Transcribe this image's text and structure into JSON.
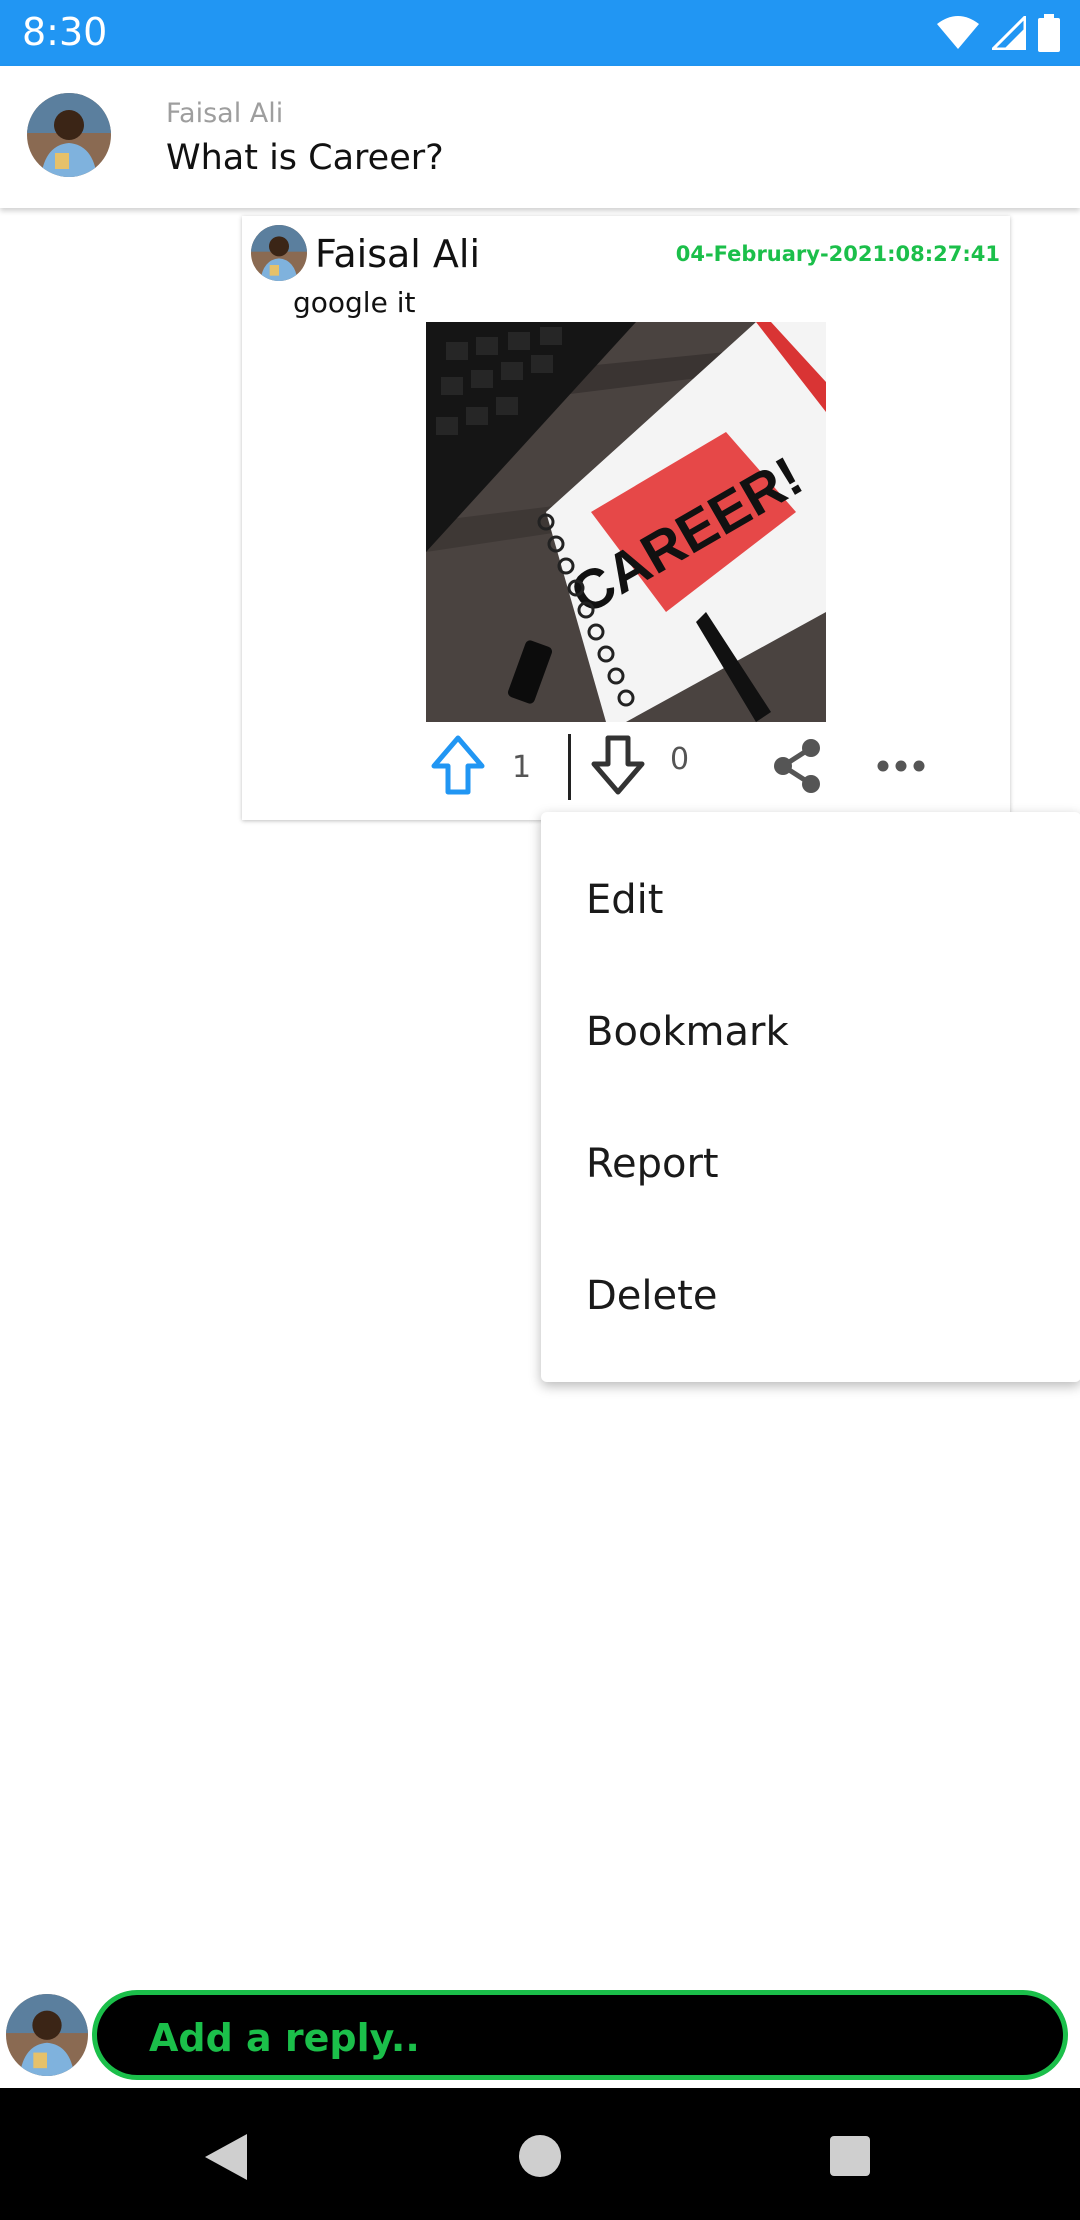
{
  "status_bar": {
    "time": "8:30"
  },
  "header": {
    "author": "Faisal Ali",
    "title": "What is Career?"
  },
  "answer": {
    "author": "Faisal Ali",
    "timestamp": "04-February-2021:08:27:41",
    "text": "google it",
    "image_text": "CAREER!",
    "upvotes": "1",
    "downvotes": "0"
  },
  "menu": {
    "items": [
      "Edit",
      "Bookmark",
      "Report",
      "Delete"
    ]
  },
  "reply": {
    "placeholder": "Add a reply.."
  },
  "colors": {
    "status_bar": "#2196F3",
    "accent_green": "#1bbf4a",
    "upvote_blue": "#2196F3"
  },
  "icons": [
    "wifi-icon",
    "signal-icon",
    "battery-icon",
    "upvote-arrow-icon",
    "downvote-arrow-icon",
    "share-icon",
    "more-options-icon",
    "back-icon",
    "home-icon",
    "recents-icon"
  ]
}
